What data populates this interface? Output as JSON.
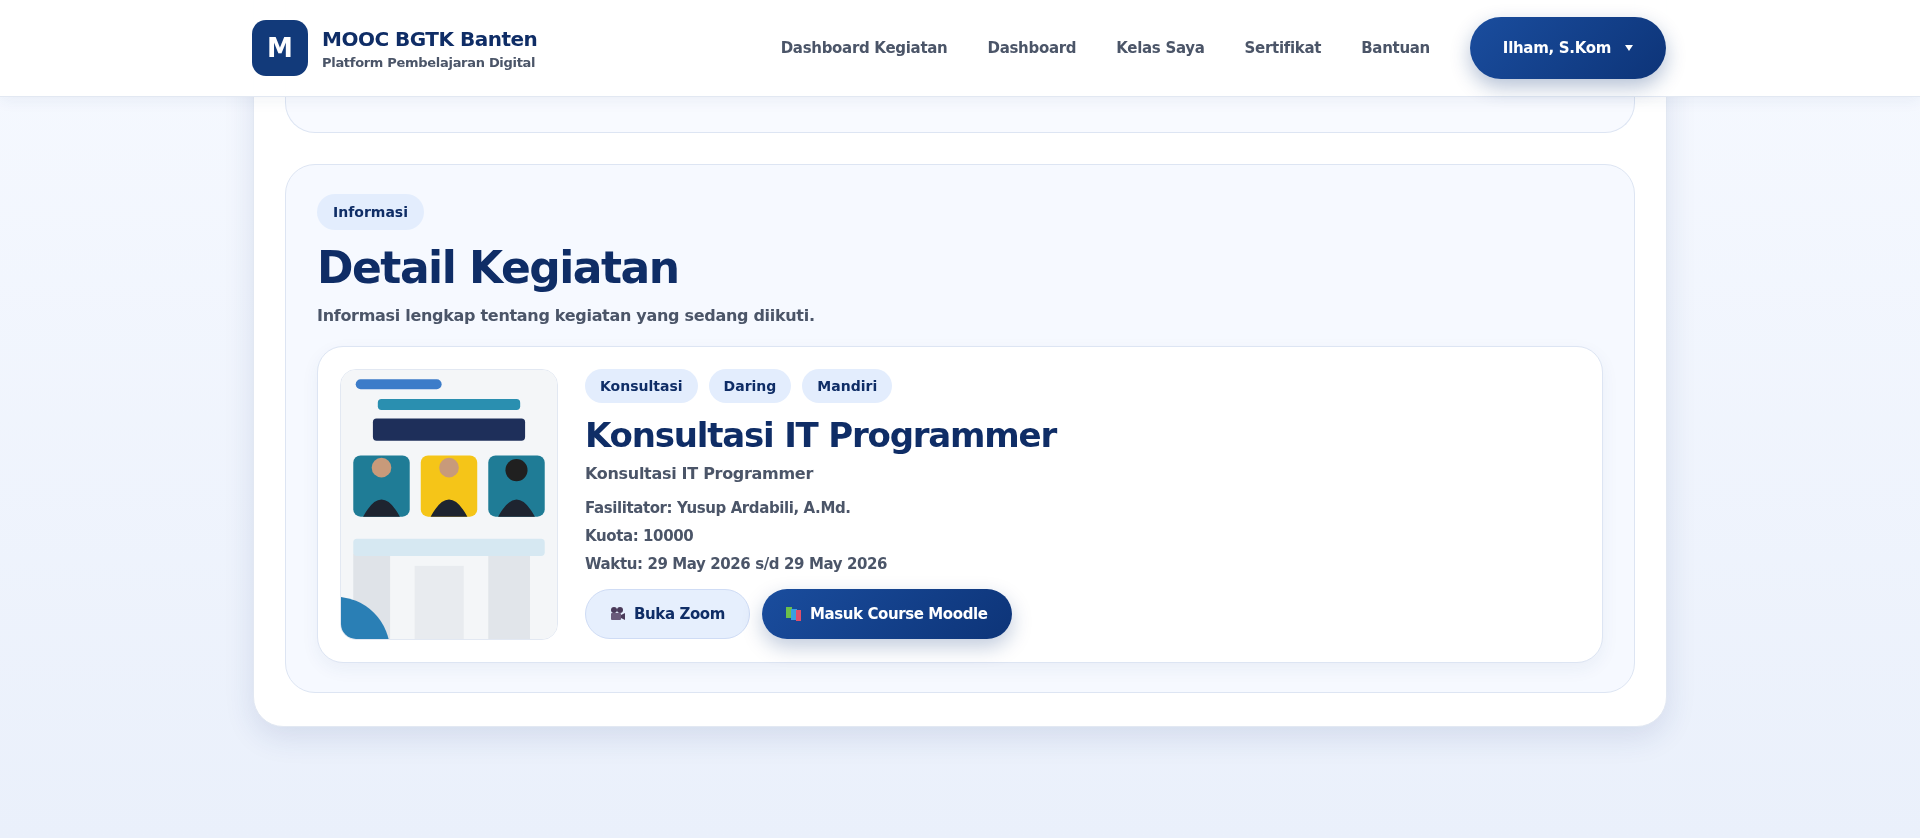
{
  "header": {
    "logo": "M",
    "brand": "MOOC BGTK Banten",
    "tagline": "Platform Pembelajaran Digital",
    "nav": [
      {
        "label": "Dashboard Kegiatan"
      },
      {
        "label": "Dashboard"
      },
      {
        "label": "Kelas Saya"
      },
      {
        "label": "Sertifikat"
      },
      {
        "label": "Bantuan"
      }
    ],
    "user_menu": "Ilham, S.Kom"
  },
  "section": {
    "badge": "Informasi",
    "title": "Detail Kegiatan",
    "subtitle": "Informasi lengkap tentang kegiatan yang sedang diikuti.",
    "activity": {
      "tags": [
        "Konsultasi",
        "Daring",
        "Mandiri"
      ],
      "title": "Konsultasi IT Programmer",
      "description": "Konsultasi IT Programmer",
      "details": [
        "Fasilitator: Yusup Ardabili, A.Md.",
        "Kuota: 10000",
        "Waktu: 29 May 2026 s/d 29 May 2026"
      ],
      "buttons": [
        {
          "kind": "zoom",
          "label": "Buka Zoom"
        },
        {
          "kind": "moodle",
          "label": "Masuk Course Moodle"
        }
      ]
    }
  }
}
